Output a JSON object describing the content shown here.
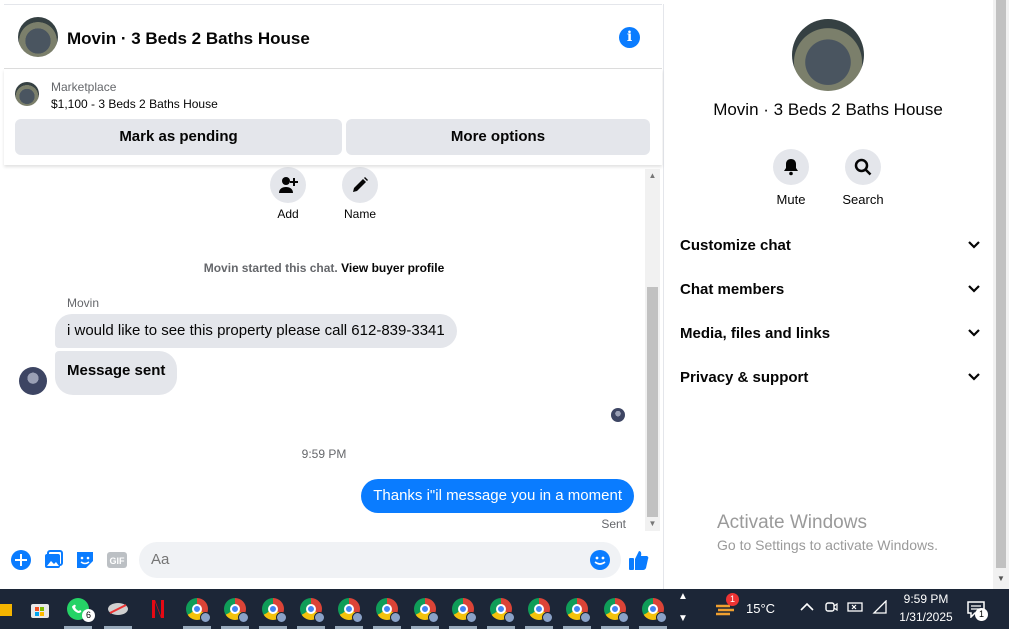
{
  "chat": {
    "title": "Movin · 3 Beds 2 Baths House",
    "marketplace_label": "Marketplace",
    "listing": "$1,100 - 3 Beds 2 Baths House",
    "mark_pending": "Mark as pending",
    "more_options": "More options",
    "actions": {
      "add": "Add",
      "name": "Name"
    },
    "system_prefix": "Movin started this chat.",
    "system_link": "View buyer profile",
    "sender_name": "Movin",
    "incoming": [
      "i would like to see this property please call 612-839-3341",
      "Message sent"
    ],
    "timestamp": "9:59 PM",
    "outgoing": "Thanks i\"il message you in a moment",
    "sent_status": "Sent",
    "composer_placeholder": "Aa",
    "gif_label": "GIF"
  },
  "side": {
    "title": "Movin · 3 Beds 2 Baths House",
    "mute": "Mute",
    "search": "Search",
    "rows": [
      "Customize chat",
      "Chat members",
      "Media, files and links",
      "Privacy & support"
    ],
    "watermark_title": "Activate Windows",
    "watermark_sub": "Go to Settings to activate Windows."
  },
  "taskbar": {
    "whatsapp_badge": "6",
    "weather_badge": "1",
    "temperature": "15°C",
    "time": "9:59 PM",
    "date": "1/31/2025",
    "notif_badge": "1"
  },
  "colors": {
    "messenger_blue": "#0a7cff",
    "taskbar": "#1c2637"
  }
}
